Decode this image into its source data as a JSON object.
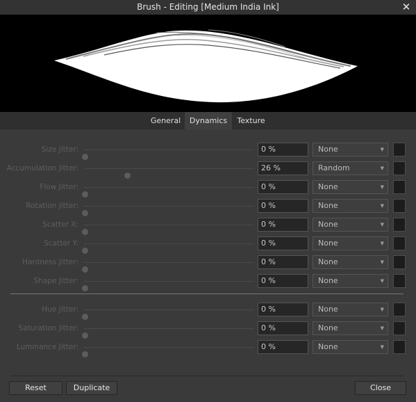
{
  "window": {
    "title": "Brush - Editing [Medium India Ink]"
  },
  "tabs": [
    "General",
    "Dynamics",
    "Texture"
  ],
  "active_tab": "Dynamics",
  "jitters_group1": [
    {
      "label": "Size Jitter:",
      "value": "0 %",
      "controller": "None"
    },
    {
      "label": "Accumulation Jitter:",
      "value": "26 %",
      "controller": "Random"
    },
    {
      "label": "Flow Jitter:",
      "value": "0 %",
      "controller": "None"
    },
    {
      "label": "Rotation Jitter:",
      "value": "0 %",
      "controller": "None"
    },
    {
      "label": "Scatter X:",
      "value": "0 %",
      "controller": "None"
    },
    {
      "label": "Scatter Y:",
      "value": "0 %",
      "controller": "None"
    },
    {
      "label": "Hardness Jitter:",
      "value": "0 %",
      "controller": "None"
    },
    {
      "label": "Shape Jitter:",
      "value": "0 %",
      "controller": "None"
    }
  ],
  "jitters_group2": [
    {
      "label": "Hue Jitter:",
      "value": "0 %",
      "controller": "None"
    },
    {
      "label": "Saturation Jitter:",
      "value": "0 %",
      "controller": "None"
    },
    {
      "label": "Luminance Jitter:",
      "value": "0 %",
      "controller": "None"
    }
  ],
  "buttons": {
    "reset": "Reset",
    "duplicate": "Duplicate",
    "close": "Close"
  },
  "colors": {
    "preview_bg": "#000000",
    "stroke": "#ffffff",
    "panel": "#3a3a3a"
  }
}
